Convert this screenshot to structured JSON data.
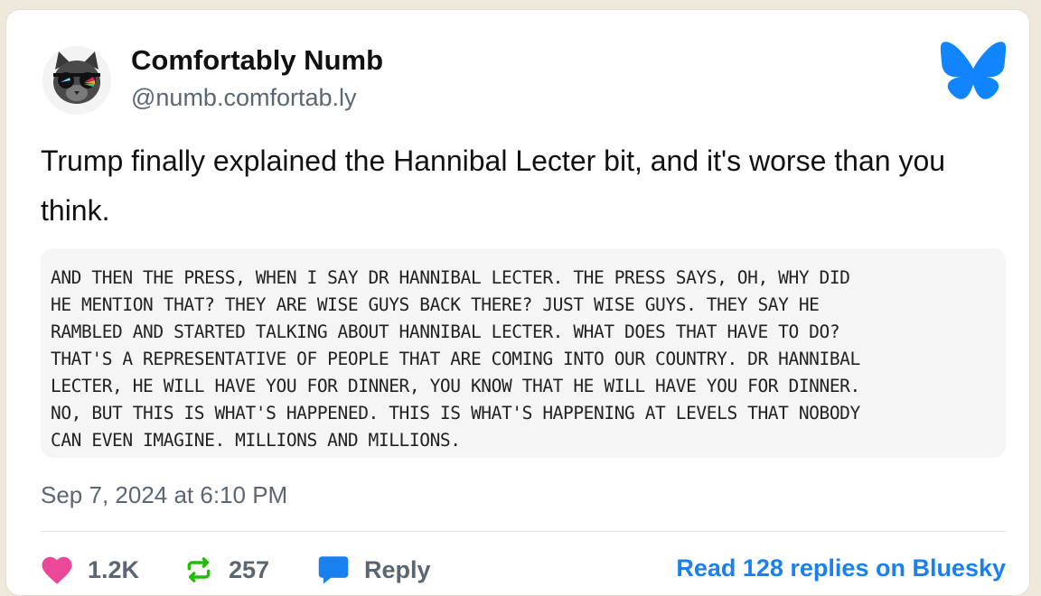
{
  "author": {
    "display_name": "Comfortably Numb",
    "handle": "@numb.comfortab.ly"
  },
  "post": {
    "text": "Trump finally explained the Hannibal Lecter bit, and it's worse than you think.",
    "quote": "AND THEN THE PRESS, WHEN I SAY DR HANNIBAL LECTER. THE PRESS SAYS, OH, WHY DID\nHE MENTION THAT? THEY ARE WISE GUYS BACK THERE? JUST WISE GUYS. THEY SAY HE\nRAMBLED AND STARTED TALKING ABOUT HANNIBAL LECTER. WHAT DOES THAT HAVE TO DO?\nTHAT'S A REPRESENTATIVE OF PEOPLE THAT ARE COMING INTO OUR COUNTRY. DR HANNIBAL\nLECTER, HE WILL HAVE YOU FOR DINNER, YOU KNOW THAT HE WILL HAVE YOU FOR DINNER.\nNO, BUT THIS IS WHAT'S HAPPENED. THIS IS WHAT'S HAPPENING AT LEVELS THAT NOBODY\nCAN EVEN IMAGINE. MILLIONS AND MILLIONS.",
    "timestamp": "Sep 7, 2024 at 6:10 PM"
  },
  "actions": {
    "likes": "1.2K",
    "reposts": "257",
    "reply_label": "Reply",
    "read_replies_label": "Read 128 replies on Bluesky"
  },
  "icons": {
    "avatar": "cat-with-sunglasses-avatar",
    "brand": "bluesky-butterfly-icon",
    "like": "heart-icon",
    "repost": "repost-icon",
    "reply": "speech-bubble-icon"
  },
  "colors": {
    "brand_blue": "#1185fe",
    "like_pink": "#ec4899",
    "repost_green": "#20bc07",
    "link_blue": "#1a80f0",
    "muted_text": "#5b6673"
  }
}
